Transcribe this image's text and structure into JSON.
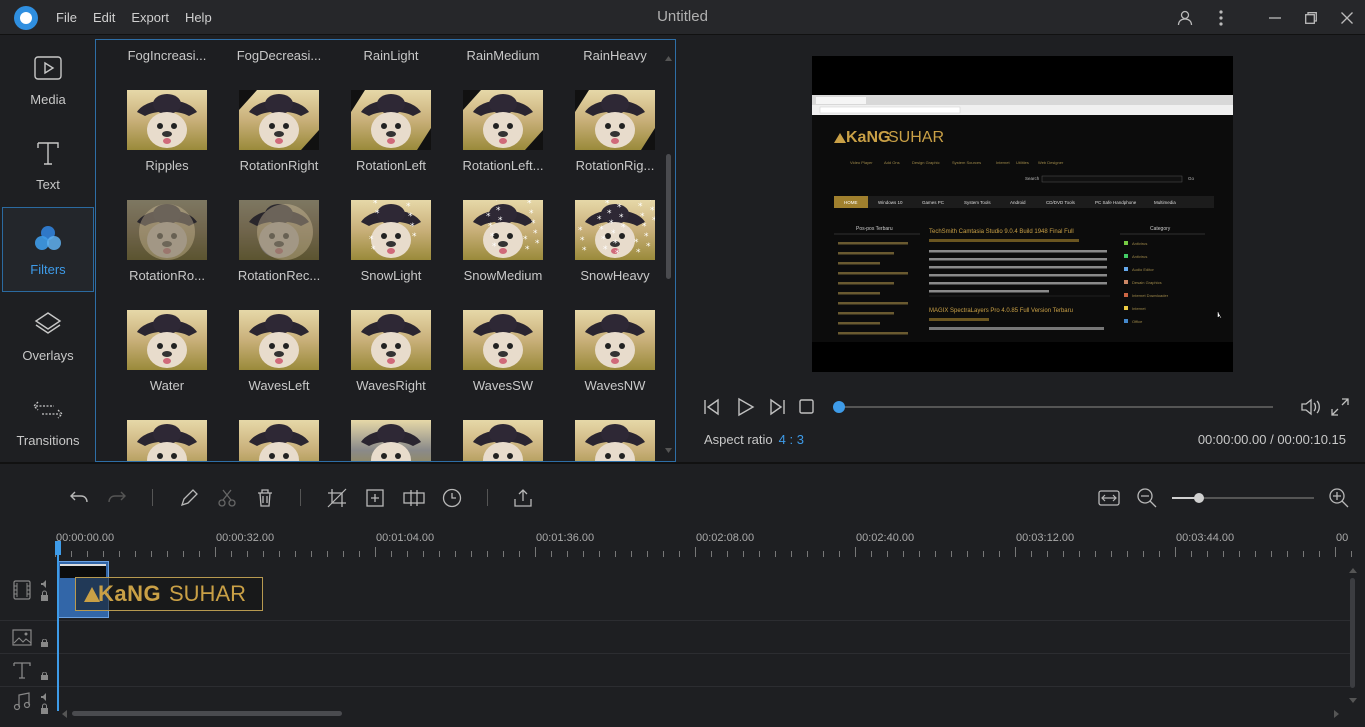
{
  "app": {
    "title": "Untitled",
    "menu": [
      "File",
      "Edit",
      "Export",
      "Help"
    ]
  },
  "sidebar": {
    "items": [
      {
        "label": "Media",
        "icon": "media-icon"
      },
      {
        "label": "Text",
        "icon": "text-icon"
      },
      {
        "label": "Filters",
        "icon": "filters-icon",
        "active": true
      },
      {
        "label": "Overlays",
        "icon": "overlays-icon"
      },
      {
        "label": "Transitions",
        "icon": "transitions-icon"
      }
    ]
  },
  "filters": {
    "items": [
      "FogIncreasi...",
      "FogDecreasi...",
      "RainLight",
      "RainMedium",
      "RainHeavy",
      "Ripples",
      "RotationRight",
      "RotationLeft",
      "RotationLeft...",
      "RotationRig...",
      "RotationRo...",
      "RotationRec...",
      "SnowLight",
      "SnowMedium",
      "SnowHeavy",
      "Water",
      "WavesLeft",
      "WavesRight",
      "WavesSW",
      "WavesNW",
      "",
      "",
      "",
      "",
      ""
    ]
  },
  "preview": {
    "aspect_label": "Aspect ratio",
    "aspect_value": "4 : 3",
    "timecode": "00:00:00.00 / 00:00:10.15",
    "progress": 0,
    "screen": {
      "brand_a": "KaNG",
      "brand_b": "SUHAR",
      "search_label": "Search",
      "go_label": "Go",
      "nav": [
        "HOME",
        "Windows 10",
        "Games PC",
        "System Tools",
        "Android",
        "CD/DVD Tools",
        "PC Safe Handphone",
        "Multimedia"
      ],
      "topnav": [
        "Video Player",
        "Add Ons",
        "Design Graphic",
        "System Sources",
        "Internet",
        "Utilities",
        "Web Designer"
      ],
      "left_head": "Pos-pos Terbaru",
      "right_head": "Category",
      "post1": "TechSmith Camtasia Studio 9.0.4 Build 1948 Final Full",
      "post2": "MAGIX SpectraLayers Pro 4.0.85 Full Version Terbaru",
      "categories": [
        "Antivirus",
        "Antivirus",
        "Audio Editor",
        "Desain Graphics",
        "Internet Downloader",
        "Internet",
        "Office"
      ]
    }
  },
  "timeline": {
    "ticks": [
      "00:00:00.00",
      "00:00:32.00",
      "00:01:04.00",
      "00:01:36.00",
      "00:02:08.00",
      "00:02:40.00",
      "00:03:12.00",
      "00:03:44.00",
      "00"
    ],
    "zoom": 0.19,
    "watermark_a": "KaNG",
    "watermark_b": "SUHAR"
  }
}
